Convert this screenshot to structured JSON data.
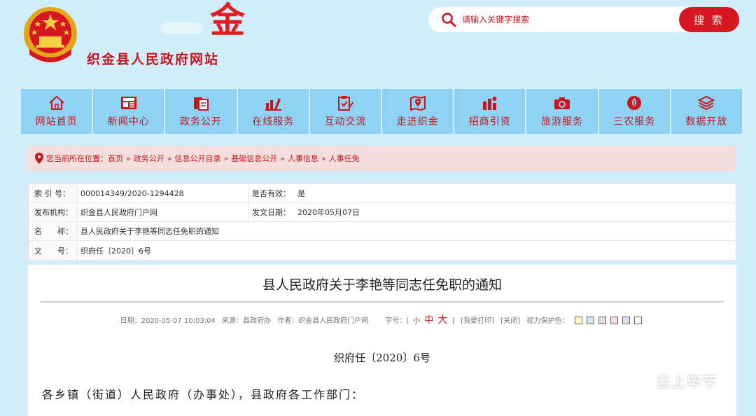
{
  "header": {
    "site_title": "织金县人民政府网站",
    "logo_char": "金",
    "search_placeholder": "请输入关键字搜索",
    "search_button": "搜 索"
  },
  "nav": [
    {
      "label": "网站首页",
      "icon": "home-icon"
    },
    {
      "label": "新闻中心",
      "icon": "news-icon"
    },
    {
      "label": "政务公开",
      "icon": "documents-icon"
    },
    {
      "label": "在线服务",
      "icon": "chart-service-icon"
    },
    {
      "label": "互动交流",
      "icon": "clipboard-edit-icon"
    },
    {
      "label": "走进织金",
      "icon": "map-pin-icon"
    },
    {
      "label": "招商引资",
      "icon": "investment-icon"
    },
    {
      "label": "旅游服务",
      "icon": "camera-icon"
    },
    {
      "label": "三农服务",
      "icon": "agriculture-icon"
    },
    {
      "label": "数据开放",
      "icon": "layers-icon"
    }
  ],
  "breadcrumb": {
    "prefix": "您当前所在位置：",
    "items": [
      "首页",
      "政务公开",
      "信息公开目录",
      "基础信息公开",
      "人事信息",
      "人事任免"
    ],
    "separator": "»"
  },
  "info": {
    "index_label": "索 引 号：",
    "index_value": "000014349/2020-1294428",
    "valid_label": "是否有效：",
    "valid_value": "是",
    "publisher_label": "发布机构：",
    "publisher_value": "织金县人民政府门户网",
    "date_label": "发文日期：",
    "date_value": "2020年05月07日",
    "name_label": "名　　称：",
    "name_value": "县人民政府关于李艳等同志任免职的通知",
    "docno_label": "文　　号：",
    "docno_value": "织府任〔2020〕6号"
  },
  "article": {
    "title": "县人民政府关于李艳等同志任免职的通知",
    "meta_date": "日期：2020-05-07 10:03:04",
    "meta_source": "来源：县政府办",
    "meta_author": "作者：织金县人民政府门户网",
    "meta_fontsize_label": "字号：[",
    "fs_small": "小",
    "fs_mid": "中",
    "fs_big": "大",
    "fs_close": "]",
    "print_link": "[我要打印]",
    "close_link": "[关闭]",
    "eye_label": "视力保护色：",
    "swatches": [
      "#fdfbc4",
      "#cfe9f6",
      "#e0e0e0",
      "#f2dede",
      "#e7dcf2",
      "#ffffff"
    ],
    "doc_no": "织府任〔2020〕6号",
    "salutation": "各乡镇（街道）人民政府（办事处），县政府各工作部门："
  },
  "watermark": "云上毕节",
  "colors": {
    "accent": "#c8161d",
    "nav_bg": "#8fd2f3",
    "page_bg": "#d3eefb"
  }
}
